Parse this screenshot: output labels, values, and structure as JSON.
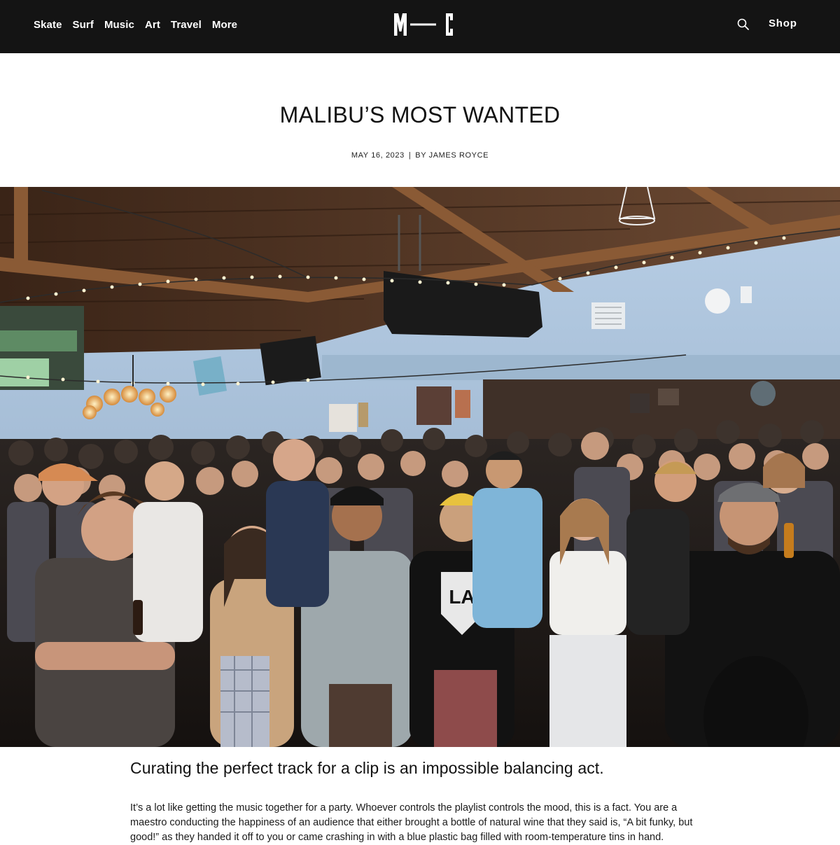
{
  "header": {
    "nav": [
      "Skate",
      "Surf",
      "Music",
      "Art",
      "Travel",
      "More"
    ],
    "logo_text": "M—C",
    "shop_label": "Shop",
    "search_icon": "search-icon"
  },
  "article": {
    "title": "MALIBU’S MOST WANTED",
    "date": "MAY 16, 2023",
    "separator": "|",
    "byline": "BY JAMES ROYCE",
    "lead": "Curating the perfect track for a clip is an impossible balancing act.",
    "body": "It’s a lot like getting the music together for a party. Whoever controls the playlist controls the mood, this is a fact. You are a maestro conducting the happiness of an audience that either brought a bottle of natural wine that they said is, “A bit funky, but good!” as they handed it off to you or came crashing in with a blue plastic bag filled with room-temperature tins in hand."
  },
  "colors": {
    "header_bg": "#141414",
    "wall_blue": "#a9c3dc",
    "wood": "#6b3f22"
  }
}
